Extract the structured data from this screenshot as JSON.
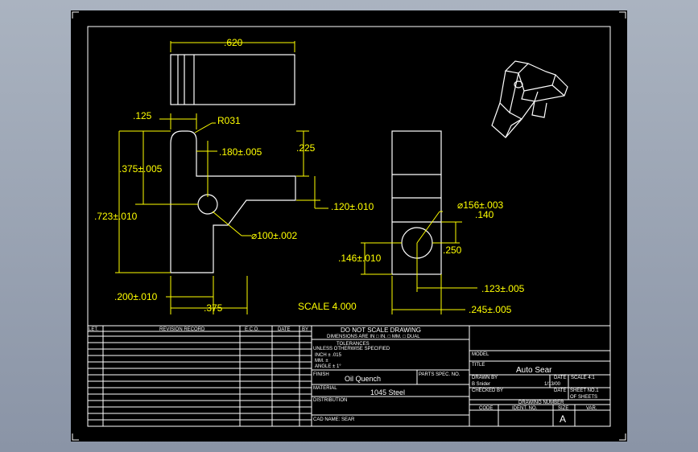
{
  "colors": {
    "background": "#000000",
    "frame": "#ffffff",
    "dimension": "#ffff00",
    "titleblock_text": "#ffffff"
  },
  "dimensions": {
    "top_width": ".620",
    "left_125": ".125",
    "radius": "R031",
    "d180": ".180±.005",
    "d225": ".225",
    "d375": ".375±.005",
    "d723": ".723±.010",
    "d120": ".120±.010",
    "hole100": "⌀100±.002",
    "d200": ".200±.010",
    "d375b": ".375",
    "scale": "SCALE   4.000",
    "hole156": "⌀156±.003",
    "depth140": ".140",
    "d250": ".250",
    "d146": ".146±.010",
    "d123": ".123±.005",
    "d245": ".245±.005"
  },
  "revision": {
    "ltr": "LET.",
    "record": "REVISION RECORD",
    "eco": "E.C.O.",
    "date": "DATE",
    "by": "BY"
  },
  "notes": {
    "do_not_scale": "DO  NOT  SCALE  DRAWING",
    "dims_are_in": "DIMENSIONS ARE IN    □ IN.   □ MM.   □ DUAL",
    "tolerances": "TOLERANCES",
    "unless": "UNLESS OTHERWISE SPECIFIED",
    "inch": "INCH  ± .015",
    "mm": "MM.   ±",
    "angle": "ANGLE ± 1°",
    "finish_label": "FINISH",
    "finish_value": "Oil Quench",
    "parts_spec": "PARTS SPEC. NO.",
    "material_label": "MATERIAL",
    "material_value": "1045 Steel",
    "distribution": "DISTRIBUTION",
    "cad_name": "CAD NAME: SEAR"
  },
  "title_block": {
    "model": "MODEL",
    "title_label": "TITLE",
    "title_value": "Auto Sear",
    "drawn_by": "DRAWN BY",
    "drawn_name": "B Snider",
    "date_label": "DATE",
    "date_value": "1/13/00",
    "scale_label": "SCALE  4:1",
    "checked_by": "CHECKED BY",
    "date_label2": "DATE",
    "sheet_label": "SHEET NO.1",
    "of_sheets": "OF     SHEETS",
    "drawing_number": "DRAWING NUMBER",
    "code": "CODE",
    "ident": "IDENT. NO.",
    "size": "SIZE",
    "size_value": "A",
    "var": "VAR."
  }
}
